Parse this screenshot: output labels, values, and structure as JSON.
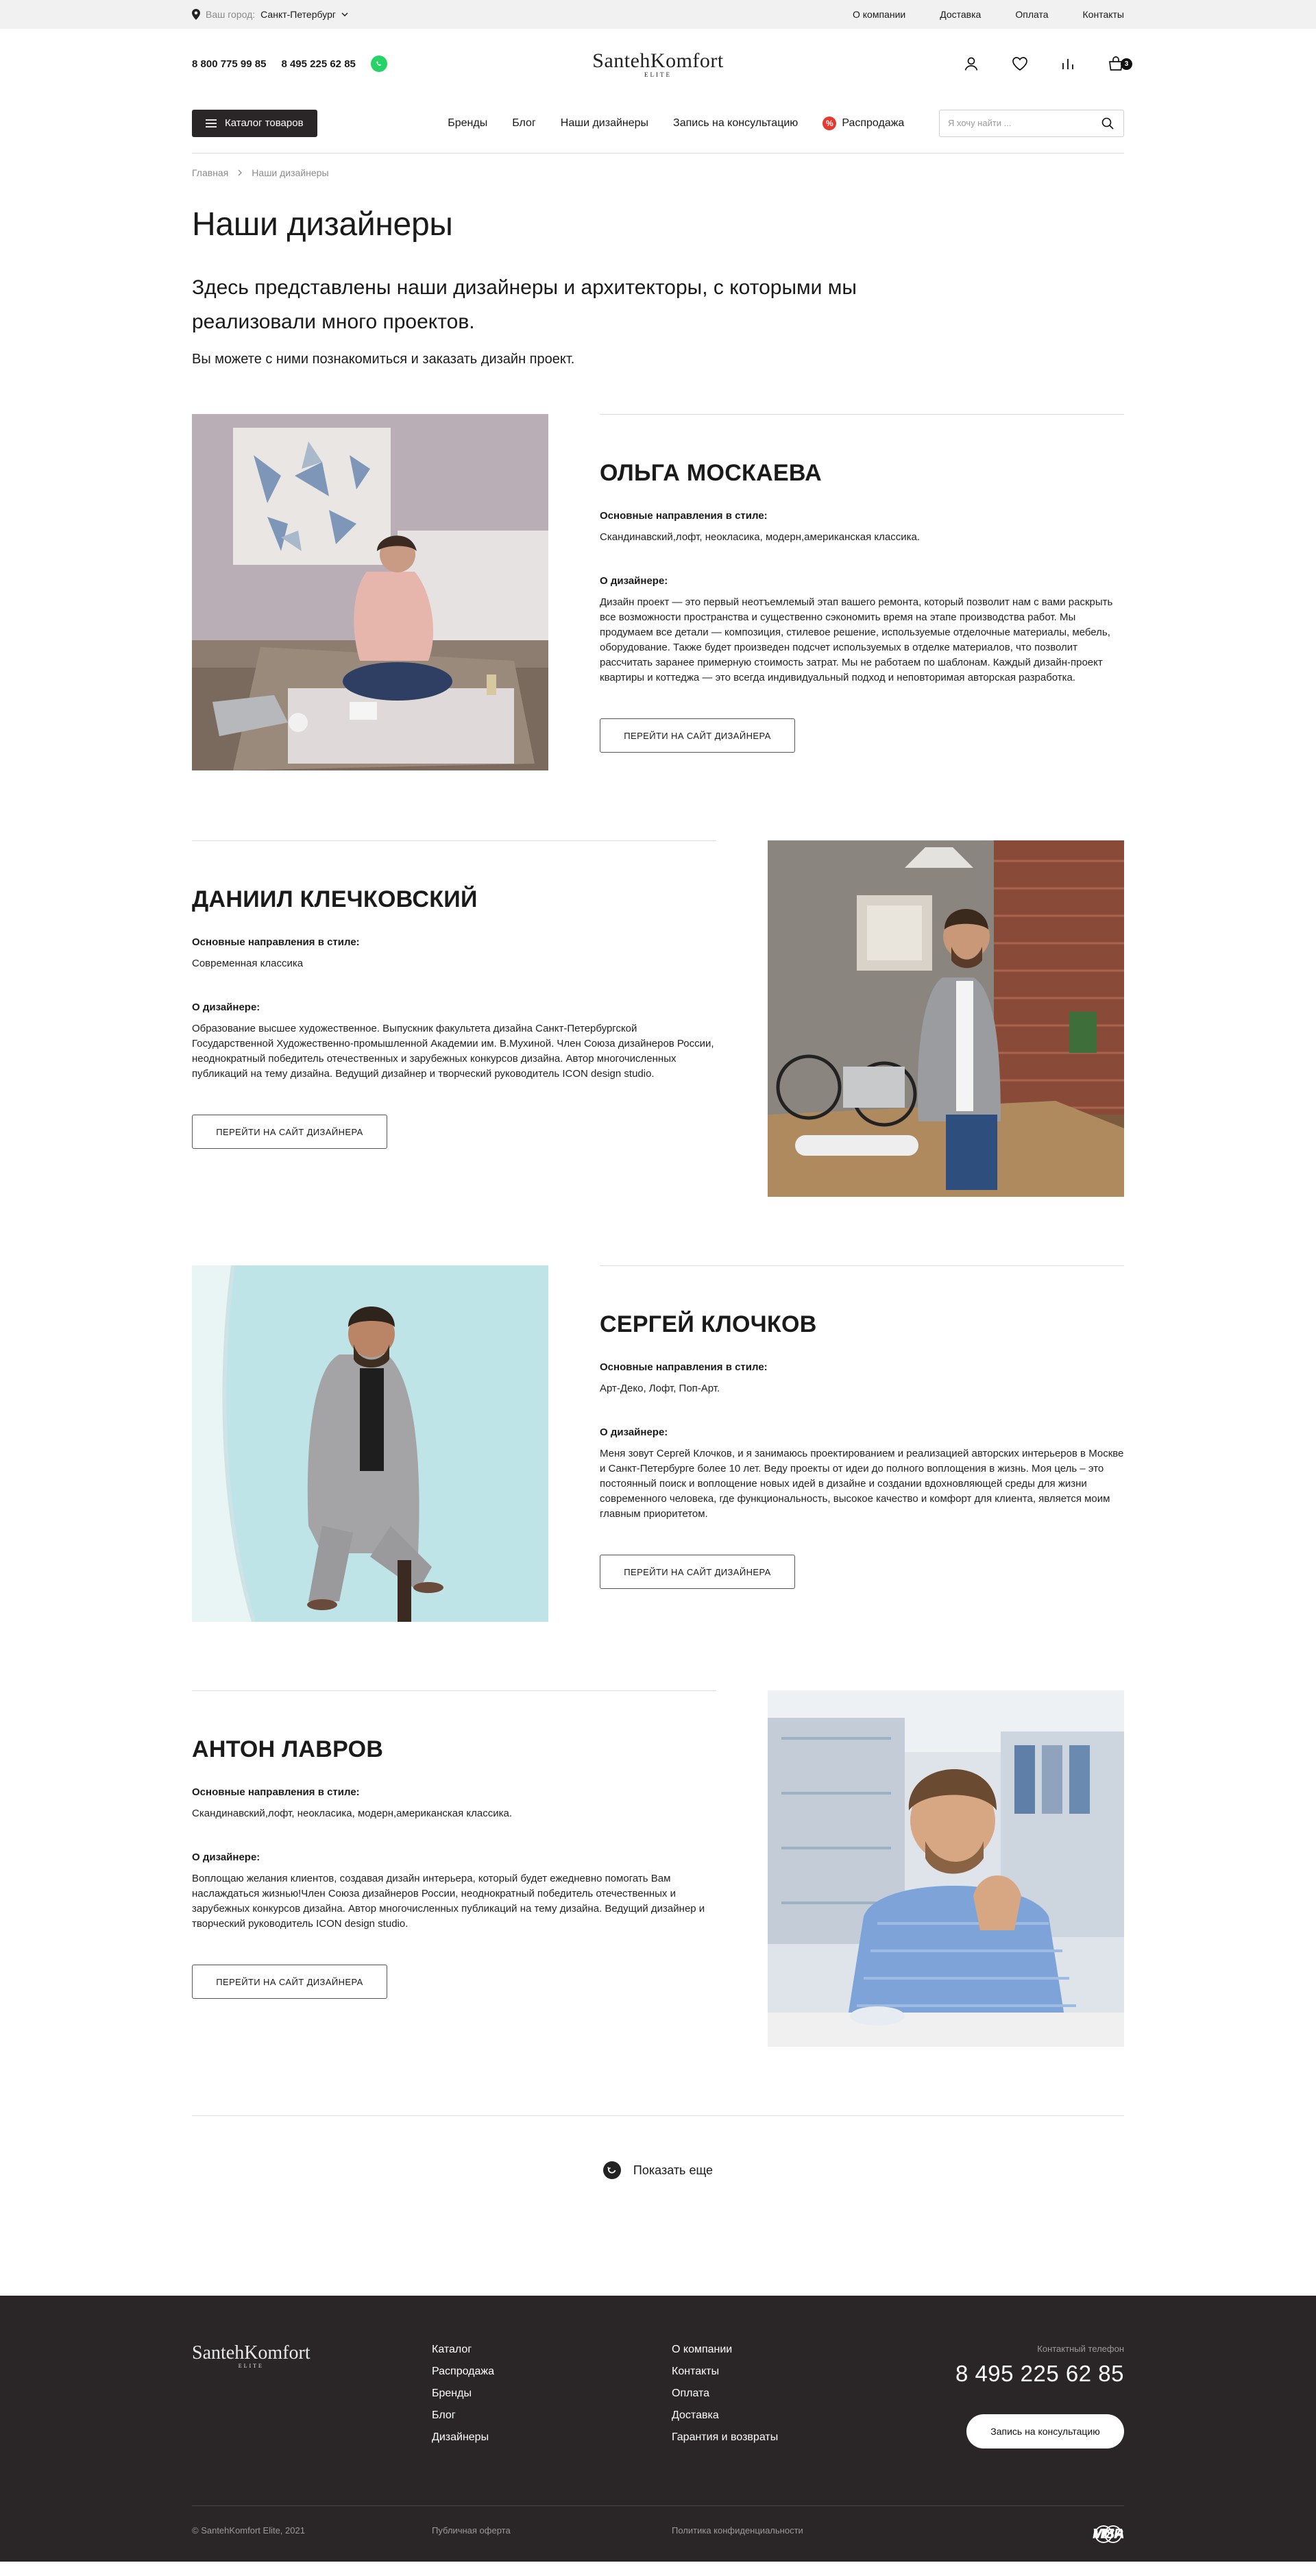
{
  "topbar": {
    "city_label": "Ваш город:",
    "city_value": "Санкт-Петербург",
    "links": [
      "О компании",
      "Доставка",
      "Оплата",
      "Контакты"
    ]
  },
  "header": {
    "phone1": "8 800 775 99 85",
    "phone2": "8 495 225 62 85",
    "logo_main": "SantehKomfort",
    "logo_sub": "ELITE",
    "cart_count": "3"
  },
  "nav": {
    "catalog": "Каталог товаров",
    "items": [
      "Бренды",
      "Блог",
      "Наши дизайнеры",
      "Запись на консультацию"
    ],
    "sale": "Распродажа",
    "sale_icon": "%",
    "search_placeholder": "Я хочу найти ..."
  },
  "breadcrumbs": [
    "Главная",
    "Наши дизайнеры"
  ],
  "page": {
    "title": "Наши дизайнеры",
    "intro": "Здесь представлены наши дизайнеры и архитекторы, с которыми мы реализовали много проектов.",
    "intro2": "Вы можете с ними познакомиться и заказать дизайн проект."
  },
  "labels": {
    "styles": "Основные направления в стиле:",
    "about": "О дизайнере:",
    "button": "ПЕРЕЙТИ НА САЙТ ДИЗАЙНЕРА"
  },
  "designers": [
    {
      "name": "ОЛЬГА МОСКАЕВА",
      "styles": "Скандинавский,лофт, неокласика, модерн,американская классика.",
      "about": "Дизайн проект — это первый неотъемлемый этап вашего ремонта, который позволит нам с вами раскрыть все возможности пространства и существенно сэкономить время на этапе производства работ. Мы продумаем все детали — композиция, стилевое решение, используемые отделочные материалы, мебель, оборудование. Также будет произведен подсчет используемых в отделке материалов, что позволит рассчитать заранее примерную стоимость затрат. Мы не работаем по шаблонам. Каждый дизайн-проект квартиры и коттеджа — это всегда индивидуальный подход и неповторимая авторская разработка."
    },
    {
      "name": "ДАНИИЛ КЛЕЧКОВСКИЙ",
      "styles": "Современная классика",
      "about": "Образование высшее художественное. Выпускник факультета дизайна Санкт-Петербургской Государственной Художественно-промышленной Академии им. В.Мухиной. Член Союза дизайнеров России, неоднократный победитель отечественных и зарубежных конкурсов дизайна. Автор многочисленных публикаций на тему дизайна. Ведущий дизайнер и творческий руководитель ICON design studio."
    },
    {
      "name": "СЕРГЕЙ КЛОЧКОВ",
      "styles": "Арт-Деко, Лофт, Поп-Арт.",
      "about": "Меня зовут Сергей Клочков, и я занимаюсь проектированием и реализацией авторских интерьеров в Москве и Санкт-Петербурге более 10 лет. Веду проекты от идеи до полного воплощения в жизнь. Моя цель – это постоянный поиск и воплощение новых идей в дизайне и создании вдохновляющей среды для жизни современного человека, где функциональность, высокое качество и комфорт для клиента, является моим главным приоритетом."
    },
    {
      "name": "АНТОН ЛАВРОВ",
      "styles": "Скандинавский,лофт, неокласика, модерн,американская классика.",
      "about": "Воплощаю желания клиентов, создавая дизайн интерьера, который будет ежедневно помогать Вам наслаждаться жизнью!Член Союза дизайнеров России, неоднократный победитель отечественных и зарубежных конкурсов дизайна. Автор многочисленных публикаций на тему дизайна. Ведущий дизайнер и творческий руководитель ICON design studio."
    }
  ],
  "load_more": "Показать еще",
  "footer": {
    "logo_main": "SantehKomfort",
    "logo_sub": "ELITE",
    "col1": [
      "Каталог",
      "Распродажа",
      "Бренды",
      "Блог",
      "Дизайнеры"
    ],
    "col2": [
      "О компании",
      "Контакты",
      "Оплата",
      "Доставка",
      "Гарантия и возвраты"
    ],
    "contact_label": "Контактный телефон",
    "phone": "8 495 225 62 85",
    "callback": "Запись на консультацию",
    "copyright": "© SantehKomfort Elite, 2021",
    "offer": "Публичная оферта",
    "privacy": "Политика конфиденциальности",
    "pay_mir": "МИР",
    "pay_visa": "VISA"
  }
}
